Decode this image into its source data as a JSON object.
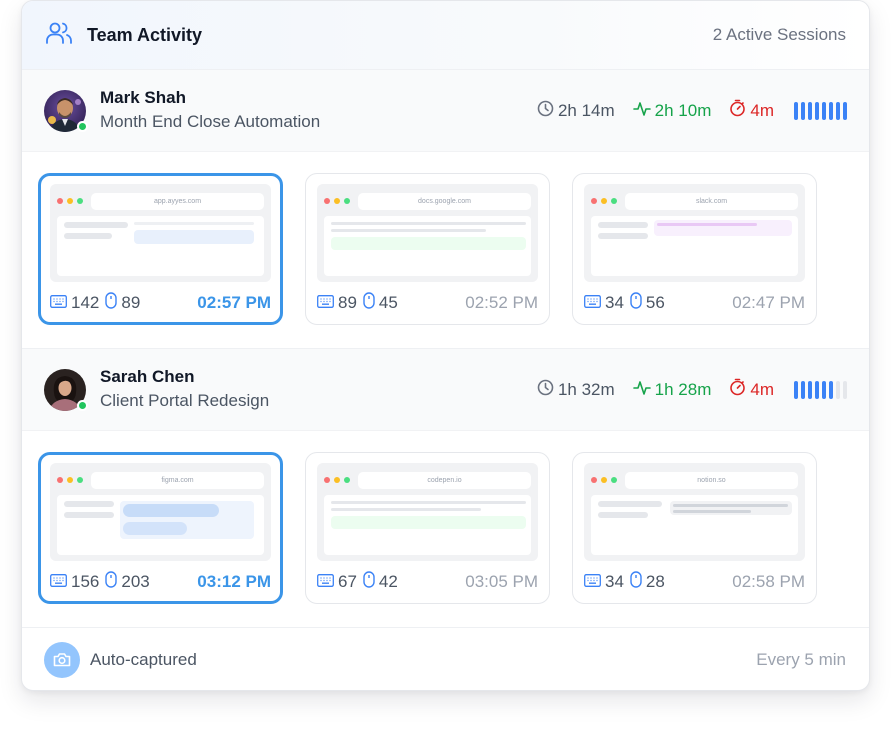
{
  "header": {
    "title": "Team Activity",
    "sessions": "2 Active Sessions",
    "icon": "users-icon"
  },
  "users": [
    {
      "name": "Mark Shah",
      "project": "Month End Close Automation",
      "status": "online",
      "total": "2h 14m",
      "active": "2h 10m",
      "idle": "4m",
      "activity_level": 1.0,
      "screenshots": [
        {
          "url": "app.ayyes.com",
          "keys": "142",
          "clicks": "89",
          "time": "02:57 PM",
          "selected": true
        },
        {
          "url": "docs.google.com",
          "keys": "89",
          "clicks": "45",
          "time": "02:52 PM",
          "selected": false
        },
        {
          "url": "slack.com",
          "keys": "34",
          "clicks": "56",
          "time": "02:47 PM",
          "selected": false
        }
      ]
    },
    {
      "name": "Sarah Chen",
      "project": "Client Portal Redesign",
      "status": "online",
      "total": "1h 32m",
      "active": "1h 28m",
      "idle": "4m",
      "activity_level": 0.7,
      "screenshots": [
        {
          "url": "figma.com",
          "keys": "156",
          "clicks": "203",
          "time": "03:12 PM",
          "selected": true
        },
        {
          "url": "codepen.io",
          "keys": "67",
          "clicks": "42",
          "time": "03:05 PM",
          "selected": false
        },
        {
          "url": "notion.so",
          "keys": "34",
          "clicks": "28",
          "time": "02:58 PM",
          "selected": false
        }
      ]
    }
  ],
  "footer": {
    "label": "Auto-captured",
    "interval": "Every 5 min",
    "icon": "camera-icon"
  },
  "colors": {
    "accent": "#3b95e8",
    "active": "#16a34a",
    "idle": "#dc2626",
    "online": "#22c55e"
  }
}
